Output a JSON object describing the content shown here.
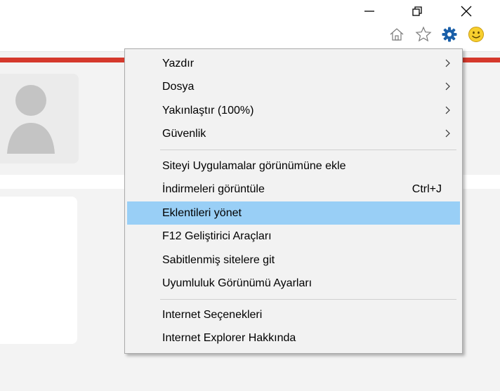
{
  "window": {
    "minimize_icon": "minimize-icon",
    "restore_icon": "restore-icon",
    "close_icon": "close-icon"
  },
  "toolbar": {
    "icons": [
      "home-icon",
      "favorites-star-icon",
      "tools-gear-icon",
      "smiley-feedback-icon"
    ],
    "gear_color": "#1a5fa8"
  },
  "page": {
    "accent_bar_color": "#d5392c",
    "avatar_icon": "user-avatar-icon"
  },
  "menu": {
    "groups": [
      {
        "items": [
          {
            "label": "Yazdır",
            "shortcut": "",
            "submenu": true
          },
          {
            "label": "Dosya",
            "shortcut": "",
            "submenu": true
          },
          {
            "label": "Yakınlaştır (100%)",
            "shortcut": "",
            "submenu": true
          },
          {
            "label": "Güvenlik",
            "shortcut": "",
            "submenu": true
          }
        ]
      },
      {
        "items": [
          {
            "label": "Siteyi Uygulamalar görünümüne ekle",
            "shortcut": "",
            "submenu": false
          },
          {
            "label": "İndirmeleri görüntüle",
            "shortcut": "Ctrl+J",
            "submenu": false
          },
          {
            "label": "Eklentileri yönet",
            "shortcut": "",
            "submenu": false,
            "highlighted": true
          },
          {
            "label": "F12 Geliştirici Araçları",
            "shortcut": "",
            "submenu": false
          },
          {
            "label": "Sabitlenmiş sitelere git",
            "shortcut": "",
            "submenu": false
          },
          {
            "label": "Uyumluluk Görünümü Ayarları",
            "shortcut": "",
            "submenu": false
          }
        ]
      },
      {
        "items": [
          {
            "label": "Internet Seçenekleri",
            "shortcut": "",
            "submenu": false
          },
          {
            "label": "Internet Explorer Hakkında",
            "shortcut": "",
            "submenu": false
          }
        ]
      }
    ],
    "highlight_color": "#99cff6"
  }
}
